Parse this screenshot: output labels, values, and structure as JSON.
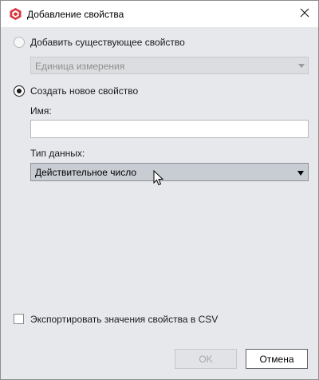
{
  "window": {
    "title": "Добавление свойства"
  },
  "options": {
    "existing_label": "Добавить существующее свойство",
    "existing_selected": false,
    "existing_combo_value": "Единица измерения",
    "new_label": "Создать новое свойство",
    "new_selected": true
  },
  "fields": {
    "name_label": "Имя:",
    "name_value": "",
    "type_label": "Тип данных:",
    "type_value": "Действительное число"
  },
  "export": {
    "label": "Экспортировать значения свойства в CSV",
    "checked": false
  },
  "buttons": {
    "ok_label": "OK",
    "cancel_label": "Отмена"
  },
  "colors": {
    "accent": "#d7373f",
    "background": "#e6e8ec"
  },
  "icons": {
    "app": "cube-icon",
    "close": "close-icon",
    "cursor": "mouse-pointer-icon"
  }
}
